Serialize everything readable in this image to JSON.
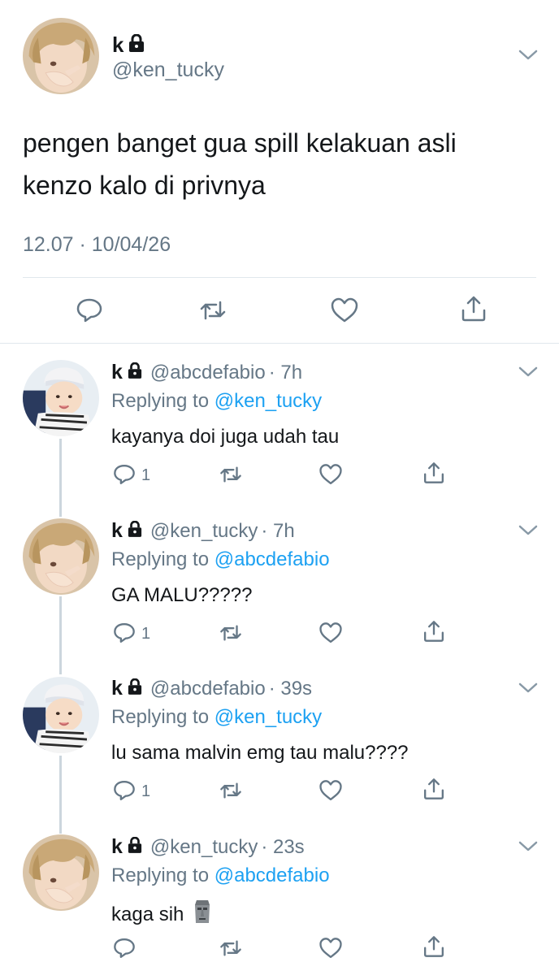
{
  "main_tweet": {
    "name": "k",
    "handle": "@ken_tucky",
    "text_line1": "pengen banget gua spill kelakuan asli",
    "text_line2": "kenzo kalo di privnya",
    "timestamp": "12.07 · 10/04/26"
  },
  "replies": [
    {
      "name": "k",
      "handle": "@abcdefabio",
      "time": "· 7h",
      "replying_prefix": "Replying to",
      "replying_to": "@ken_tucky",
      "text": "kayanya doi juga udah tau",
      "reply_count": "1",
      "avatar": "baby-avatar"
    },
    {
      "name": "k",
      "handle": "@ken_tucky",
      "time": "· 7h",
      "replying_prefix": "Replying to",
      "replying_to": "@abcdefabio",
      "text": "GA MALU?????",
      "reply_count": "1",
      "avatar": "blonde-avatar"
    },
    {
      "name": "k",
      "handle": "@abcdefabio",
      "time": "· 39s",
      "replying_prefix": "Replying to",
      "replying_to": "@ken_tucky",
      "text": "lu sama malvin emg tau malu????",
      "reply_count": "1",
      "avatar": "baby-avatar"
    },
    {
      "name": "k",
      "handle": "@ken_tucky",
      "time": "· 23s",
      "replying_prefix": "Replying to",
      "replying_to": "@abcdefabio",
      "text": "kaga sih",
      "reply_count": "",
      "avatar": "blonde-avatar",
      "emoji": "moai-emoji"
    }
  ],
  "colors": {
    "link": "#1da1f2",
    "secondary_text": "#657786",
    "primary_text": "#14171a",
    "divider": "#e1e8ed",
    "thread_line": "#ccd6dd"
  },
  "icons": [
    "lock-icon",
    "chevron-down-icon",
    "reply-icon",
    "retweet-icon",
    "like-icon",
    "share-icon"
  ]
}
